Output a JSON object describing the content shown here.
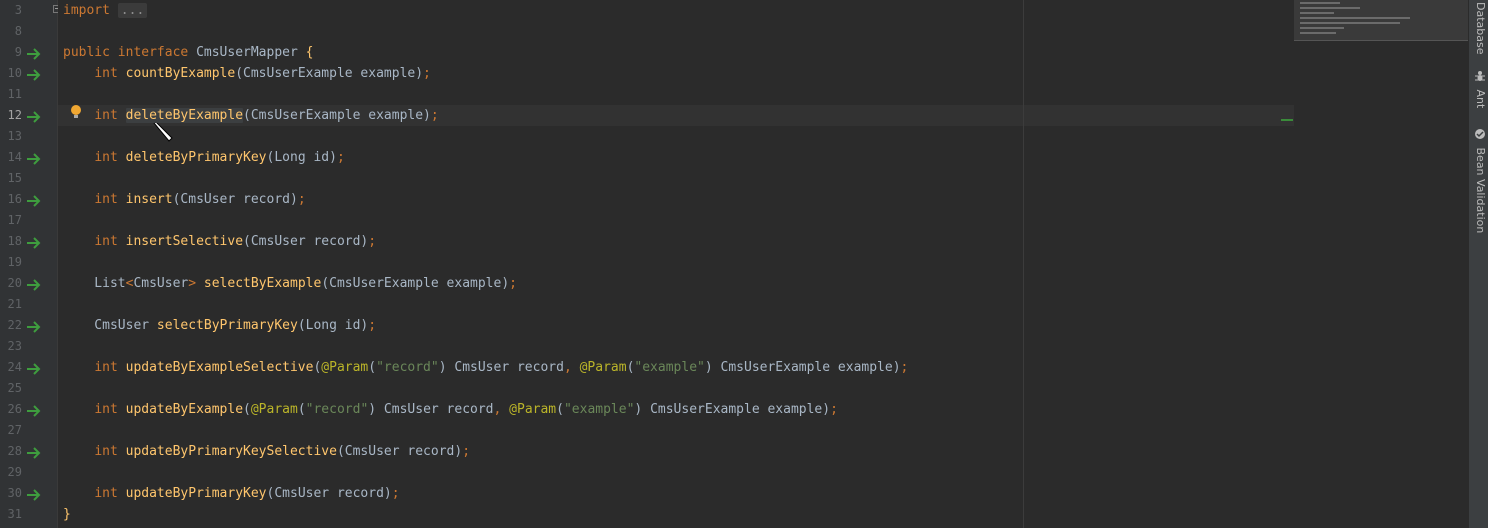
{
  "editor": {
    "lines": [
      {
        "n": "3",
        "impl": false,
        "tokens": [
          [
            "kw",
            "import "
          ],
          [
            "fold",
            "..."
          ]
        ]
      },
      {
        "n": "8",
        "impl": false,
        "tokens": []
      },
      {
        "n": "9",
        "impl": true,
        "tokens": [
          [
            "kw",
            "public interface "
          ],
          [
            "txt",
            "CmsUserMapper "
          ],
          [
            "fn",
            "{"
          ]
        ]
      },
      {
        "n": "10",
        "impl": true,
        "tokens": [
          [
            "txt",
            "    "
          ],
          [
            "kw",
            "int "
          ],
          [
            "fn",
            "countByExample"
          ],
          [
            "txt",
            "(CmsUserExample example)"
          ],
          [
            "kw",
            ";"
          ]
        ]
      },
      {
        "n": "11",
        "impl": false,
        "tokens": []
      },
      {
        "n": "12",
        "impl": true,
        "current": true,
        "tokens": [
          [
            "txt",
            "    "
          ],
          [
            "kw",
            "int "
          ],
          [
            "fnhl",
            "deleteByExample"
          ],
          [
            "txt",
            "(CmsUserExample example)"
          ],
          [
            "kw",
            ";"
          ]
        ]
      },
      {
        "n": "13",
        "impl": false,
        "tokens": []
      },
      {
        "n": "14",
        "impl": true,
        "tokens": [
          [
            "txt",
            "    "
          ],
          [
            "kw",
            "int "
          ],
          [
            "fn",
            "deleteByPrimaryKey"
          ],
          [
            "txt",
            "(Long id)"
          ],
          [
            "kw",
            ";"
          ]
        ]
      },
      {
        "n": "15",
        "impl": false,
        "tokens": []
      },
      {
        "n": "16",
        "impl": true,
        "tokens": [
          [
            "txt",
            "    "
          ],
          [
            "kw",
            "int "
          ],
          [
            "fn",
            "insert"
          ],
          [
            "txt",
            "(CmsUser record)"
          ],
          [
            "kw",
            ";"
          ]
        ]
      },
      {
        "n": "17",
        "impl": false,
        "tokens": []
      },
      {
        "n": "18",
        "impl": true,
        "tokens": [
          [
            "txt",
            "    "
          ],
          [
            "kw",
            "int "
          ],
          [
            "fn",
            "insertSelective"
          ],
          [
            "txt",
            "(CmsUser record)"
          ],
          [
            "kw",
            ";"
          ]
        ]
      },
      {
        "n": "19",
        "impl": false,
        "tokens": []
      },
      {
        "n": "20",
        "impl": true,
        "tokens": [
          [
            "txt",
            "    List"
          ],
          [
            "kw",
            "<"
          ],
          [
            "txt",
            "CmsUser"
          ],
          [
            "kw",
            "> "
          ],
          [
            "fn",
            "selectByExample"
          ],
          [
            "txt",
            "(CmsUserExample example)"
          ],
          [
            "kw",
            ";"
          ]
        ]
      },
      {
        "n": "21",
        "impl": false,
        "tokens": []
      },
      {
        "n": "22",
        "impl": true,
        "tokens": [
          [
            "txt",
            "    CmsUser "
          ],
          [
            "fn",
            "selectByPrimaryKey"
          ],
          [
            "txt",
            "(Long id)"
          ],
          [
            "kw",
            ";"
          ]
        ]
      },
      {
        "n": "23",
        "impl": false,
        "tokens": []
      },
      {
        "n": "24",
        "impl": true,
        "tokens": [
          [
            "txt",
            "    "
          ],
          [
            "kw",
            "int "
          ],
          [
            "fn",
            "updateByExampleSelective"
          ],
          [
            "txt",
            "("
          ],
          [
            "ann",
            "@Param"
          ],
          [
            "txt",
            "("
          ],
          [
            "str",
            "\"record\""
          ],
          [
            "txt",
            ") CmsUser record"
          ],
          [
            "kw",
            ", "
          ],
          [
            "ann",
            "@Param"
          ],
          [
            "txt",
            "("
          ],
          [
            "str",
            "\"example\""
          ],
          [
            "txt",
            ") CmsUserExample example)"
          ],
          [
            "kw",
            ";"
          ]
        ]
      },
      {
        "n": "25",
        "impl": false,
        "tokens": []
      },
      {
        "n": "26",
        "impl": true,
        "tokens": [
          [
            "txt",
            "    "
          ],
          [
            "kw",
            "int "
          ],
          [
            "fn",
            "updateByExample"
          ],
          [
            "txt",
            "("
          ],
          [
            "ann",
            "@Param"
          ],
          [
            "txt",
            "("
          ],
          [
            "str",
            "\"record\""
          ],
          [
            "txt",
            ") CmsUser record"
          ],
          [
            "kw",
            ", "
          ],
          [
            "ann",
            "@Param"
          ],
          [
            "txt",
            "("
          ],
          [
            "str",
            "\"example\""
          ],
          [
            "txt",
            ") CmsUserExample example)"
          ],
          [
            "kw",
            ";"
          ]
        ]
      },
      {
        "n": "27",
        "impl": false,
        "tokens": []
      },
      {
        "n": "28",
        "impl": true,
        "tokens": [
          [
            "txt",
            "    "
          ],
          [
            "kw",
            "int "
          ],
          [
            "fn",
            "updateByPrimaryKeySelective"
          ],
          [
            "txt",
            "(CmsUser record)"
          ],
          [
            "kw",
            ";"
          ]
        ]
      },
      {
        "n": "29",
        "impl": false,
        "tokens": []
      },
      {
        "n": "30",
        "impl": true,
        "tokens": [
          [
            "txt",
            "    "
          ],
          [
            "kw",
            "int "
          ],
          [
            "fn",
            "updateByPrimaryKey"
          ],
          [
            "txt",
            "(CmsUser record)"
          ],
          [
            "kw",
            ";"
          ]
        ]
      },
      {
        "n": "31",
        "impl": false,
        "tokens": [
          [
            "fn",
            "}"
          ]
        ]
      }
    ]
  },
  "tool_windows": [
    {
      "label": "Database",
      "icon": ""
    },
    {
      "label": "Ant",
      "icon": "ant-icon"
    },
    {
      "label": "Bean Validation",
      "icon": "bean-validation-icon"
    }
  ],
  "colors": {
    "keyword": "#cc7832",
    "method": "#ffc66d",
    "string": "#6a8759",
    "annotation": "#bbb529",
    "text": "#a9b7c6",
    "background": "#2b2b2b"
  }
}
